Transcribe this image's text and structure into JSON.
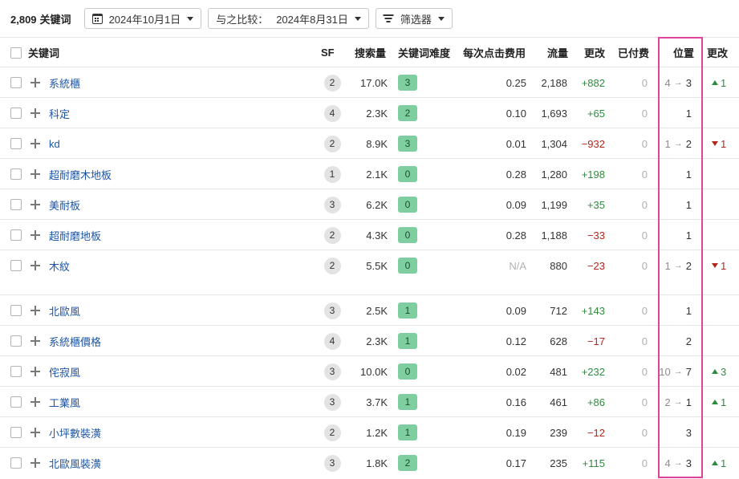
{
  "toolbar": {
    "keyword_count": "2,809",
    "keyword_count_label": "关键词",
    "date": "2024年10月1日",
    "compare_label": "与之比较：",
    "compare_date": "2024年8月31日",
    "filter_label": "筛选器"
  },
  "columns": {
    "keyword": "关键词",
    "sf": "SF",
    "volume": "搜索量",
    "kd": "关键词难度",
    "cpc": "每次点击费用",
    "traffic": "流量",
    "change": "更改",
    "paid": "已付费",
    "position": "位置",
    "pos_change": "更改"
  },
  "colors": {
    "link": "#1d55a6",
    "kd_badge": "#7fcea0",
    "positive": "#2f8a3f",
    "negative": "#b3261e",
    "highlight": "#e0439e"
  },
  "rows": [
    {
      "keyword": "系統櫃",
      "sf": "2",
      "volume": "17.0K",
      "kd": "3",
      "cpc": "0.25",
      "traffic": "2,188",
      "change": "+882",
      "change_sign": "up",
      "paid": "0",
      "pos_from": "4",
      "pos_to": "3",
      "pos_change": "1",
      "pos_dir": "up"
    },
    {
      "keyword": "科定",
      "sf": "4",
      "volume": "2.3K",
      "kd": "2",
      "cpc": "0.10",
      "traffic": "1,693",
      "change": "+65",
      "change_sign": "up",
      "paid": "0",
      "pos_from": "",
      "pos_to": "1",
      "pos_change": "",
      "pos_dir": ""
    },
    {
      "keyword": "kd",
      "sf": "2",
      "volume": "8.9K",
      "kd": "3",
      "cpc": "0.01",
      "traffic": "1,304",
      "change": "−932",
      "change_sign": "down",
      "paid": "0",
      "pos_from": "1",
      "pos_to": "2",
      "pos_change": "1",
      "pos_dir": "down"
    },
    {
      "keyword": "超耐磨木地板",
      "sf": "1",
      "volume": "2.1K",
      "kd": "0",
      "cpc": "0.28",
      "traffic": "1,280",
      "change": "+198",
      "change_sign": "up",
      "paid": "0",
      "pos_from": "",
      "pos_to": "1",
      "pos_change": "",
      "pos_dir": ""
    },
    {
      "keyword": "美耐板",
      "sf": "3",
      "volume": "6.2K",
      "kd": "0",
      "cpc": "0.09",
      "traffic": "1,199",
      "change": "+35",
      "change_sign": "up",
      "paid": "0",
      "pos_from": "",
      "pos_to": "1",
      "pos_change": "",
      "pos_dir": ""
    },
    {
      "keyword": "超耐磨地板",
      "sf": "2",
      "volume": "4.3K",
      "kd": "0",
      "cpc": "0.28",
      "traffic": "1,188",
      "change": "−33",
      "change_sign": "down",
      "paid": "0",
      "pos_from": "",
      "pos_to": "1",
      "pos_change": "",
      "pos_dir": ""
    },
    {
      "keyword": "木紋",
      "sf": "2",
      "volume": "5.5K",
      "kd": "0",
      "cpc": "N/A",
      "traffic": "880",
      "change": "−23",
      "change_sign": "down",
      "paid": "0",
      "pos_from": "1",
      "pos_to": "2",
      "pos_change": "1",
      "pos_dir": "down"
    },
    {
      "keyword": "北歐風",
      "sf": "3",
      "volume": "2.5K",
      "kd": "1",
      "cpc": "0.09",
      "traffic": "712",
      "change": "+143",
      "change_sign": "up",
      "paid": "0",
      "pos_from": "",
      "pos_to": "1",
      "pos_change": "",
      "pos_dir": ""
    },
    {
      "keyword": "系統櫃價格",
      "sf": "4",
      "volume": "2.3K",
      "kd": "1",
      "cpc": "0.12",
      "traffic": "628",
      "change": "−17",
      "change_sign": "down",
      "paid": "0",
      "pos_from": "",
      "pos_to": "2",
      "pos_change": "",
      "pos_dir": ""
    },
    {
      "keyword": "侘寂風",
      "sf": "3",
      "volume": "10.0K",
      "kd": "0",
      "cpc": "0.02",
      "traffic": "481",
      "change": "+232",
      "change_sign": "up",
      "paid": "0",
      "pos_from": "10",
      "pos_to": "7",
      "pos_change": "3",
      "pos_dir": "up"
    },
    {
      "keyword": "工業風",
      "sf": "3",
      "volume": "3.7K",
      "kd": "1",
      "cpc": "0.16",
      "traffic": "461",
      "change": "+86",
      "change_sign": "up",
      "paid": "0",
      "pos_from": "2",
      "pos_to": "1",
      "pos_change": "1",
      "pos_dir": "up"
    },
    {
      "keyword": "小坪數裝潢",
      "sf": "2",
      "volume": "1.2K",
      "kd": "1",
      "cpc": "0.19",
      "traffic": "239",
      "change": "−12",
      "change_sign": "down",
      "paid": "0",
      "pos_from": "",
      "pos_to": "3",
      "pos_change": "",
      "pos_dir": ""
    },
    {
      "keyword": "北歐風裝潢",
      "sf": "3",
      "volume": "1.8K",
      "kd": "2",
      "cpc": "0.17",
      "traffic": "235",
      "change": "+115",
      "change_sign": "up",
      "paid": "0",
      "pos_from": "4",
      "pos_to": "3",
      "pos_change": "1",
      "pos_dir": "up"
    }
  ]
}
